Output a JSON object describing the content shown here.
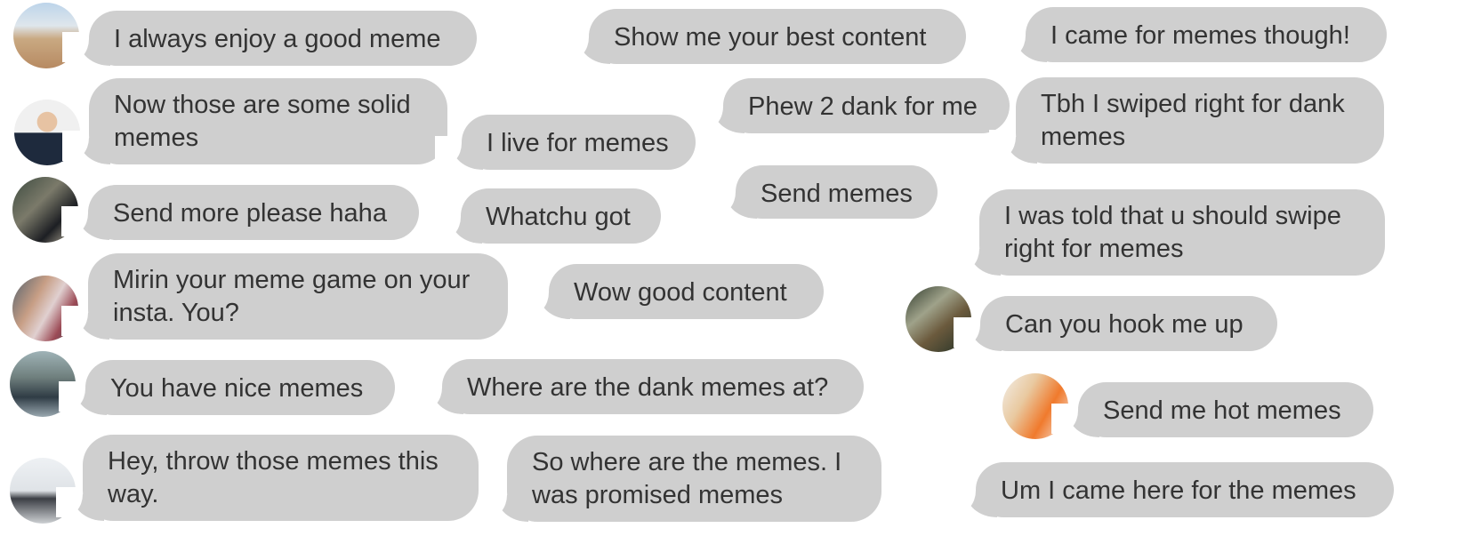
{
  "messages": [
    {
      "text": "I always enjoy a good meme"
    },
    {
      "text": "Show me your best content"
    },
    {
      "text": "I came for memes though!"
    },
    {
      "text": "Now those are some solid\nmemes"
    },
    {
      "text": "I live for memes"
    },
    {
      "text": "Phew 2 dank for me"
    },
    {
      "text": "Tbh I swiped right for dank\nmemes"
    },
    {
      "text": "Send memes"
    },
    {
      "text": "Send more please haha"
    },
    {
      "text": "Whatchu got"
    },
    {
      "text": "I was told that u should swipe\nright for memes"
    },
    {
      "text": "Mirin your meme game on your\ninsta. You?"
    },
    {
      "text": "Wow good content"
    },
    {
      "text": "Can you hook me up"
    },
    {
      "text": "You have nice memes"
    },
    {
      "text": "Where are the dank memes at?"
    },
    {
      "text": "Send me hot memes"
    },
    {
      "text": "Hey, throw those memes this\nway."
    },
    {
      "text": "So where are the memes.  I\nwas promised memes"
    },
    {
      "text": "Um I came here for the memes"
    }
  ]
}
